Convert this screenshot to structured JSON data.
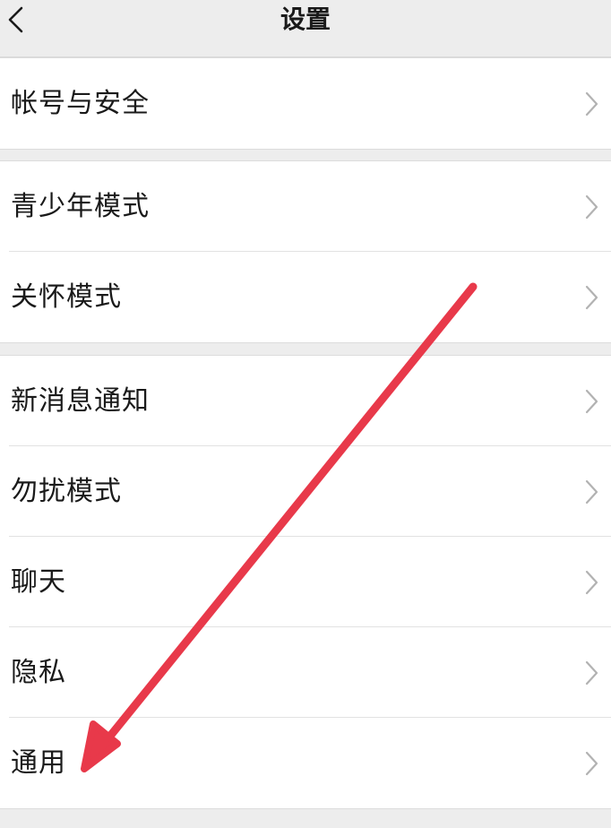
{
  "header": {
    "title": "设置"
  },
  "groups": [
    {
      "items": [
        {
          "label": "帐号与安全"
        }
      ]
    },
    {
      "items": [
        {
          "label": "青少年模式"
        },
        {
          "label": "关怀模式"
        }
      ]
    },
    {
      "items": [
        {
          "label": "新消息通知"
        },
        {
          "label": "勿扰模式"
        },
        {
          "label": "聊天"
        },
        {
          "label": "隐私"
        },
        {
          "label": "通用"
        }
      ]
    }
  ],
  "icons": {
    "back": "chevron-left-icon",
    "row_chevron": "chevron-right-icon"
  },
  "annotation": {
    "color": "#e8394a",
    "target": "通用"
  },
  "colors": {
    "background": "#ededed",
    "card": "#ffffff",
    "text": "#1a1a1a",
    "chevron": "#b2b2b2"
  }
}
